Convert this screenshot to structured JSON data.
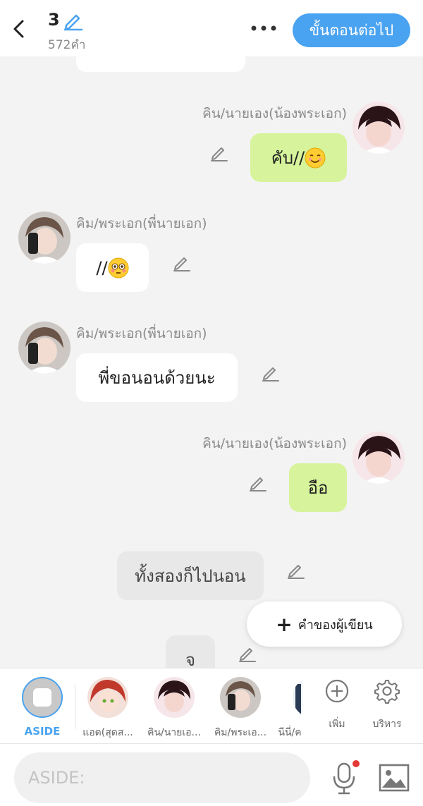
{
  "header": {
    "chapter_number": "3",
    "word_count": "572คำ",
    "next_label": "ขั้นตอนต่อไป"
  },
  "messages": [
    {
      "speaker": "คิน/นายเอง(น้องพระเอก)",
      "text": "คับ//",
      "emoji": "smiling-face-emoji"
    },
    {
      "speaker": "คิม/พระเอก(พี่นายเอก)",
      "text": "//",
      "emoji": "flushed-face-emoji"
    },
    {
      "speaker": "คิม/พระเอก(พี่นายเอก)",
      "text": "พี่ขอนอนด้วยนะ"
    },
    {
      "speaker": "คิน/นายเอง(น้องพระเอก)",
      "text": "อือ"
    },
    {
      "text": "ทั้งสองก็ไปนอน"
    },
    {
      "text": "จ"
    }
  ],
  "writer_button": {
    "label": "คำของผู้เขียน"
  },
  "characters": {
    "aside_label": "ASIDE",
    "items": [
      {
        "label": "แอด(สุดส..."
      },
      {
        "label": "คิน/นายเอ..."
      },
      {
        "label": "คิม/พระเอ..."
      },
      {
        "label": "นีนี่/ค"
      }
    ],
    "add_label": "เพิ่ม",
    "manage_label": "บริหาร"
  },
  "input": {
    "placeholder": "ASIDE:"
  },
  "colors": {
    "accent": "#4aa3f0",
    "green_bubble": "#d7f39b",
    "recording_dot": "#e53935"
  }
}
